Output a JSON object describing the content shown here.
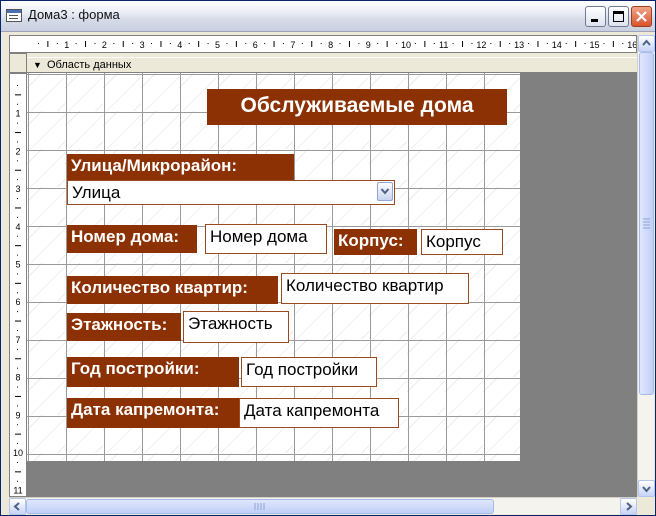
{
  "window": {
    "title": "Дома3 : форма"
  },
  "section": {
    "label": "Область данных"
  },
  "ruler": {
    "h_numbers": [
      "1",
      "2",
      "3",
      "4",
      "5",
      "6",
      "7",
      "8",
      "9",
      "10",
      "11",
      "12",
      "13",
      "14",
      "15",
      "16"
    ],
    "v_numbers": [
      "1",
      "2",
      "3",
      "4",
      "5",
      "6",
      "7",
      "8",
      "9",
      "10",
      "11"
    ]
  },
  "form": {
    "title": "Обслуживаемые дома",
    "street_label": "Улица/Микрорайон:",
    "street_value": "Улица",
    "house_number_label": "Номер дома:",
    "house_number_value": "Номер дома",
    "building_label": "Корпус:",
    "building_value": "Корпус",
    "apartments_label": "Количество квартир:",
    "apartments_value": "Количество квартир",
    "floors_label": "Этажность:",
    "floors_value": "Этажность",
    "year_built_label": "Год постройки:",
    "year_built_value": "Год постройки",
    "repair_date_label": "Дата капремонта:",
    "repair_date_value": "Дата капремонта"
  },
  "colors": {
    "label_bg": "#8b3103",
    "label_text": "#ffffff",
    "canvas_bg": "#808080"
  },
  "icons": {
    "app": "form-window-icon",
    "section": "section-arrow-icon",
    "dropdown": "chevron-down-icon"
  }
}
